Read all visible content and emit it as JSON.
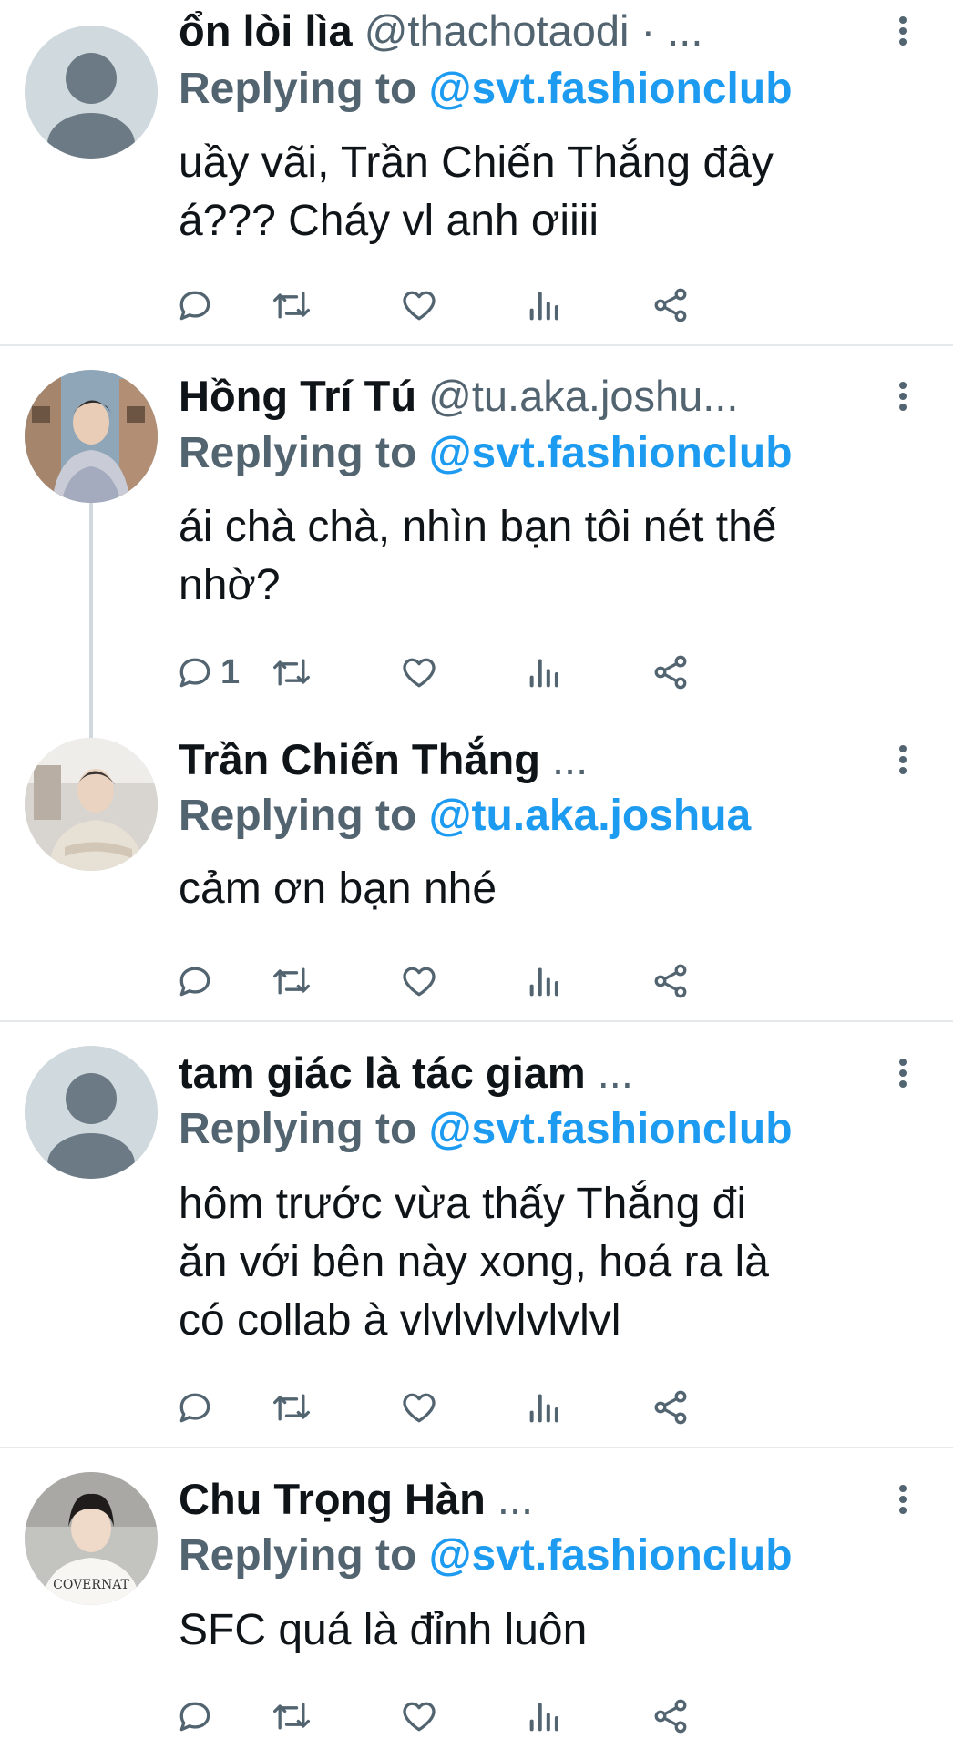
{
  "replying_label": "Replying to",
  "tweets": [
    {
      "name": "ổn lòi lìa",
      "handle": "@thachotaodi · ...",
      "reply_to": "@svt.fashionclub",
      "text_lines": [
        "uầy vãi, Trần Chiến Thắng đây",
        "á??? Cháy vl anh ơiiii"
      ],
      "reply_count": "",
      "avatar": "default-avatar"
    },
    {
      "name": "Hồng Trí Tú",
      "handle": "@tu.aka.joshu...",
      "reply_to": "@svt.fashionclub",
      "text_lines": [
        "ái chà chà, nhìn bạn tôi nét thế",
        "nhờ?"
      ],
      "reply_count": "1",
      "avatar": "photo-avatar"
    },
    {
      "name": "Trần Chiến Thắng",
      "handle": "...",
      "reply_to": "@tu.aka.joshua",
      "text_lines": [
        "cảm ơn bạn nhé"
      ],
      "reply_count": "",
      "avatar": "photo-avatar"
    },
    {
      "name": "tam giác là tác giam",
      "handle": "...",
      "reply_to": "@svt.fashionclub",
      "text_lines": [
        "hôm trước vừa thấy Thắng đi",
        "ăn với bên này xong, hoá ra là",
        "có collab à vlvlvlvlvlvlvl"
      ],
      "reply_count": "",
      "avatar": "default-avatar"
    },
    {
      "name": "Chu Trọng Hàn",
      "handle": "...",
      "reply_to": "@svt.fashionclub",
      "text_lines": [
        "SFC quá là đỉnh luôn"
      ],
      "reply_count": "",
      "avatar": "photo-avatar"
    }
  ],
  "icons": {
    "reply": "comment-bubble-icon",
    "retweet": "retweet-icon",
    "like": "heart-icon",
    "views": "analytics-icon",
    "share": "share-icon",
    "more": "vertical-dots-icon"
  },
  "colors": {
    "text": "#0f1419",
    "secondary": "#536471",
    "mention": "#1d9bf0",
    "divider": "#e6e9eb"
  }
}
